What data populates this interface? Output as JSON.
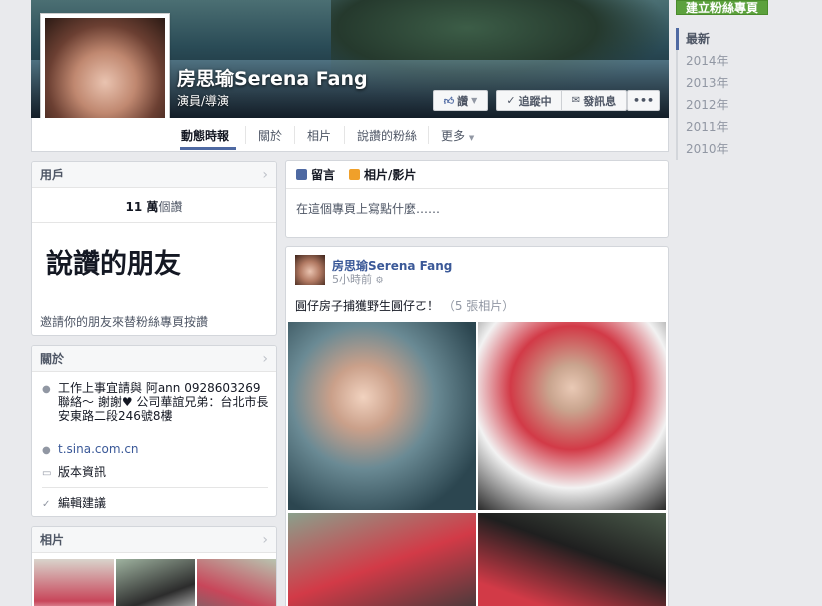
{
  "profile": {
    "name": "房思瑜Serena Fang",
    "category": "演員/導演"
  },
  "cover_buttons": {
    "like": "讚",
    "follow": "追蹤中",
    "message": "發訊息",
    "more": "•••"
  },
  "tabs": [
    "動態時報",
    "關於",
    "相片",
    "說讚的粉絲",
    "更多"
  ],
  "sidebar_right": {
    "create_page": "建立粉絲專頁",
    "years": [
      "最新",
      "2014年",
      "2013年",
      "2012年",
      "2011年",
      "2010年"
    ]
  },
  "users_card": {
    "title": "用戶",
    "likes_number": "11 萬",
    "likes_suffix": "個讚",
    "friends_title": "說讚的朋友",
    "invite_text": "邀請你的朋友來替粉絲專頁按讚"
  },
  "about_card": {
    "title": "關於",
    "contact": "工作上事宜請與 阿ann 0928603269 聯絡～ 謝謝♥ 公司華誼兄弟：台北市長安東路二段246號8樓",
    "website": "t.sina.com.cn",
    "page_info": "版本資訊",
    "suggest_edits": "編輯建議"
  },
  "photos_card": {
    "title": "相片"
  },
  "composer": {
    "tab_post": "留言",
    "tab_photo": "相片/影片",
    "placeholder": "在這個專頁上寫點什麼……"
  },
  "post": {
    "author": "房思瑜Serena Fang",
    "time": "5小時前",
    "text": "圓仔房子捕獲野生圓仔ㄛ！",
    "photo_count": "（5 張相片）"
  },
  "colors": {
    "link": "#3b5998",
    "create_page_green": "#5ca13d",
    "tab_underline": "#4e69a2"
  }
}
